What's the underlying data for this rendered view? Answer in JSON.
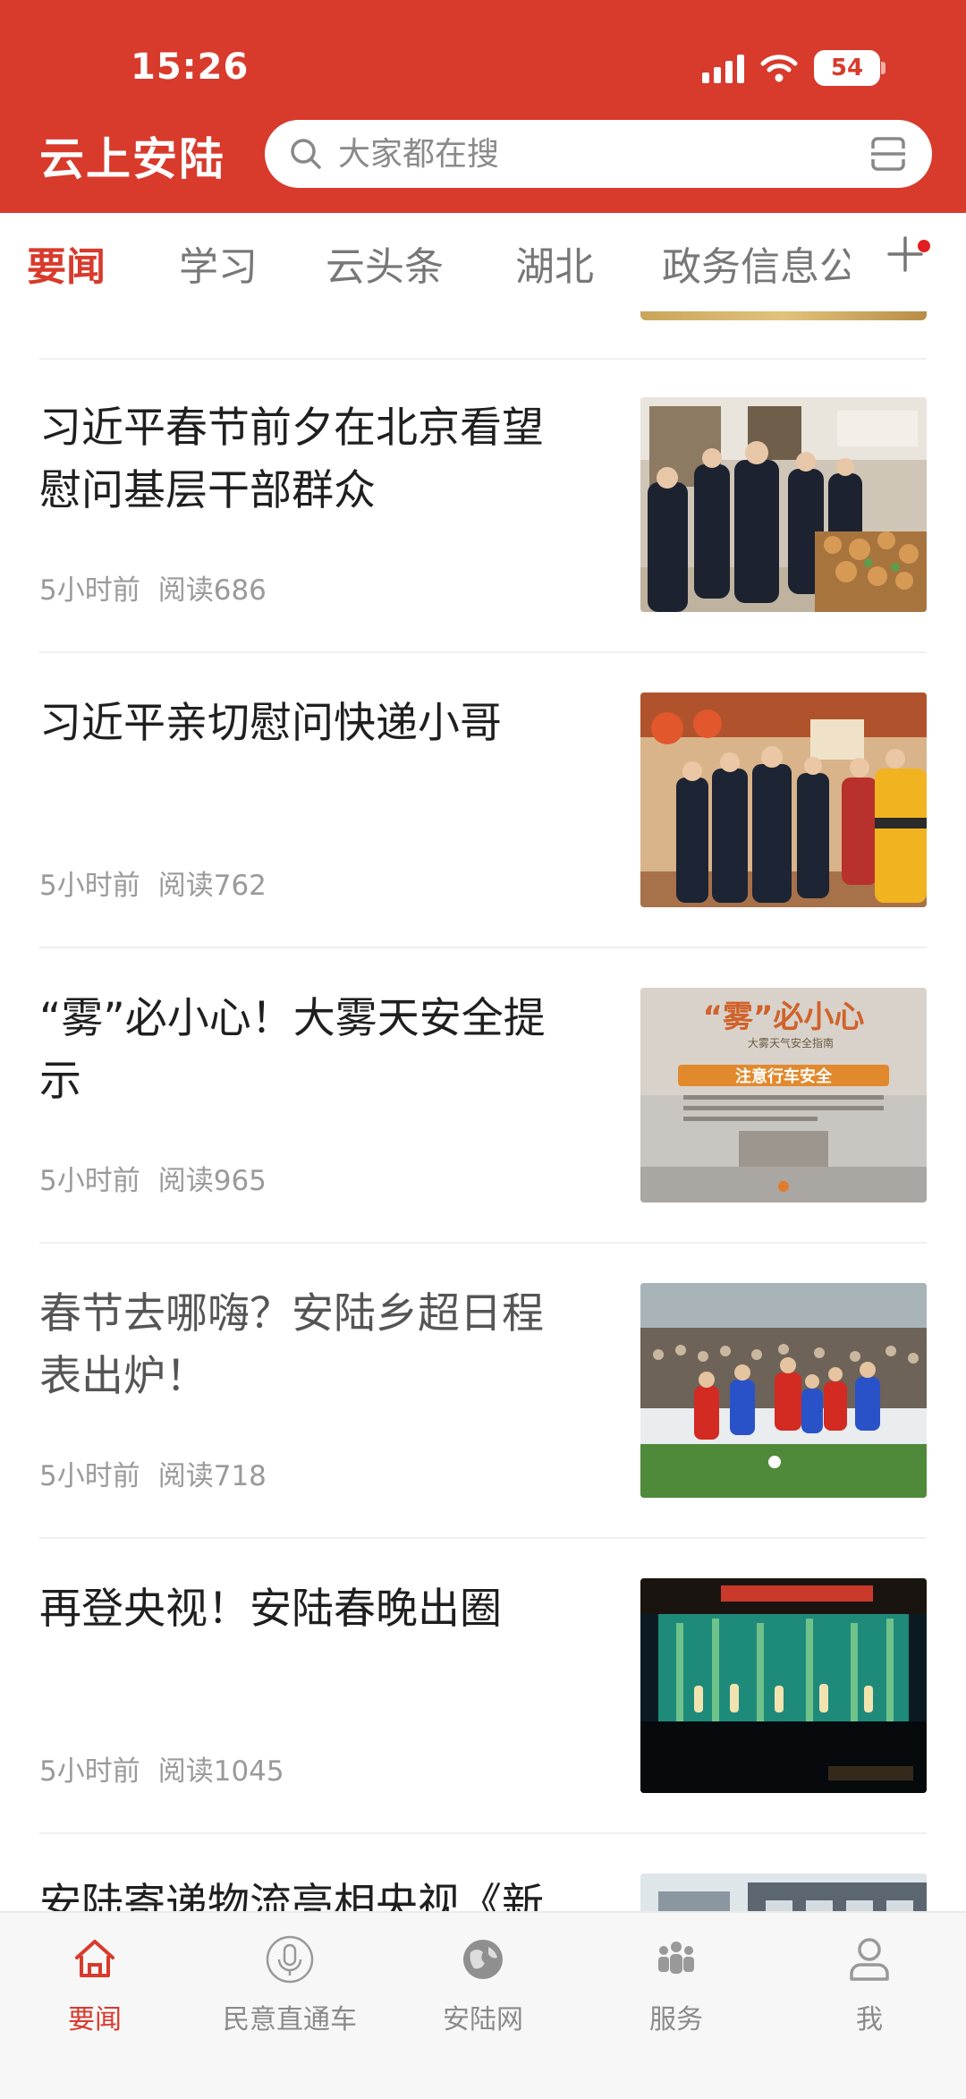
{
  "status": {
    "time": "15:26",
    "battery": "54"
  },
  "header": {
    "title": "云上安陆",
    "search_placeholder": "大家都在搜"
  },
  "tabs": [
    {
      "label": "要闻",
      "active": true
    },
    {
      "label": "学习"
    },
    {
      "label": "云头条"
    },
    {
      "label": "湖北"
    },
    {
      "label": "政务信息公"
    }
  ],
  "articles": [
    {
      "title": "习近平春节前夕在北京看望慰问基层干部群众",
      "time": "5小时前",
      "reads": "阅读686",
      "thumb": "leaders-visiting-market"
    },
    {
      "title": "习近平亲切慰问快递小哥",
      "time": "5小时前",
      "reads": "阅读762",
      "thumb": "courier-visit"
    },
    {
      "title": "“雾”必小心！大雾天安全提示",
      "time": "5小时前",
      "reads": "阅读965",
      "thumb": "fog-safety-poster"
    },
    {
      "title": "春节去哪嗨？安陆乡超日程表出炉！",
      "time": "5小时前",
      "reads": "阅读718",
      "thumb": "football-match"
    },
    {
      "title": "再登央视！安陆春晚出圈",
      "time": "5小时前",
      "reads": "阅读1045",
      "thumb": "spring-gala-stage"
    },
    {
      "title": "安陆寄递物流亮相央视《新",
      "time": "",
      "reads": "",
      "thumb": "logistics-building"
    }
  ],
  "thumb_text": {
    "fog_big": "“雾”必小心",
    "fog_sub": "大雾天气安全指南",
    "fog_banner": "注意行车安全"
  },
  "bottom_nav": [
    {
      "label": "要闻",
      "icon": "home-icon",
      "active": true
    },
    {
      "label": "民意直通车",
      "icon": "microphone-icon"
    },
    {
      "label": "安陆网",
      "icon": "globe-icon"
    },
    {
      "label": "服务",
      "icon": "people-icon"
    },
    {
      "label": "我",
      "icon": "person-icon"
    }
  ],
  "colors": {
    "brand": "#d83a2c",
    "text": "#1f1f1f",
    "meta": "#9a9a9a"
  }
}
